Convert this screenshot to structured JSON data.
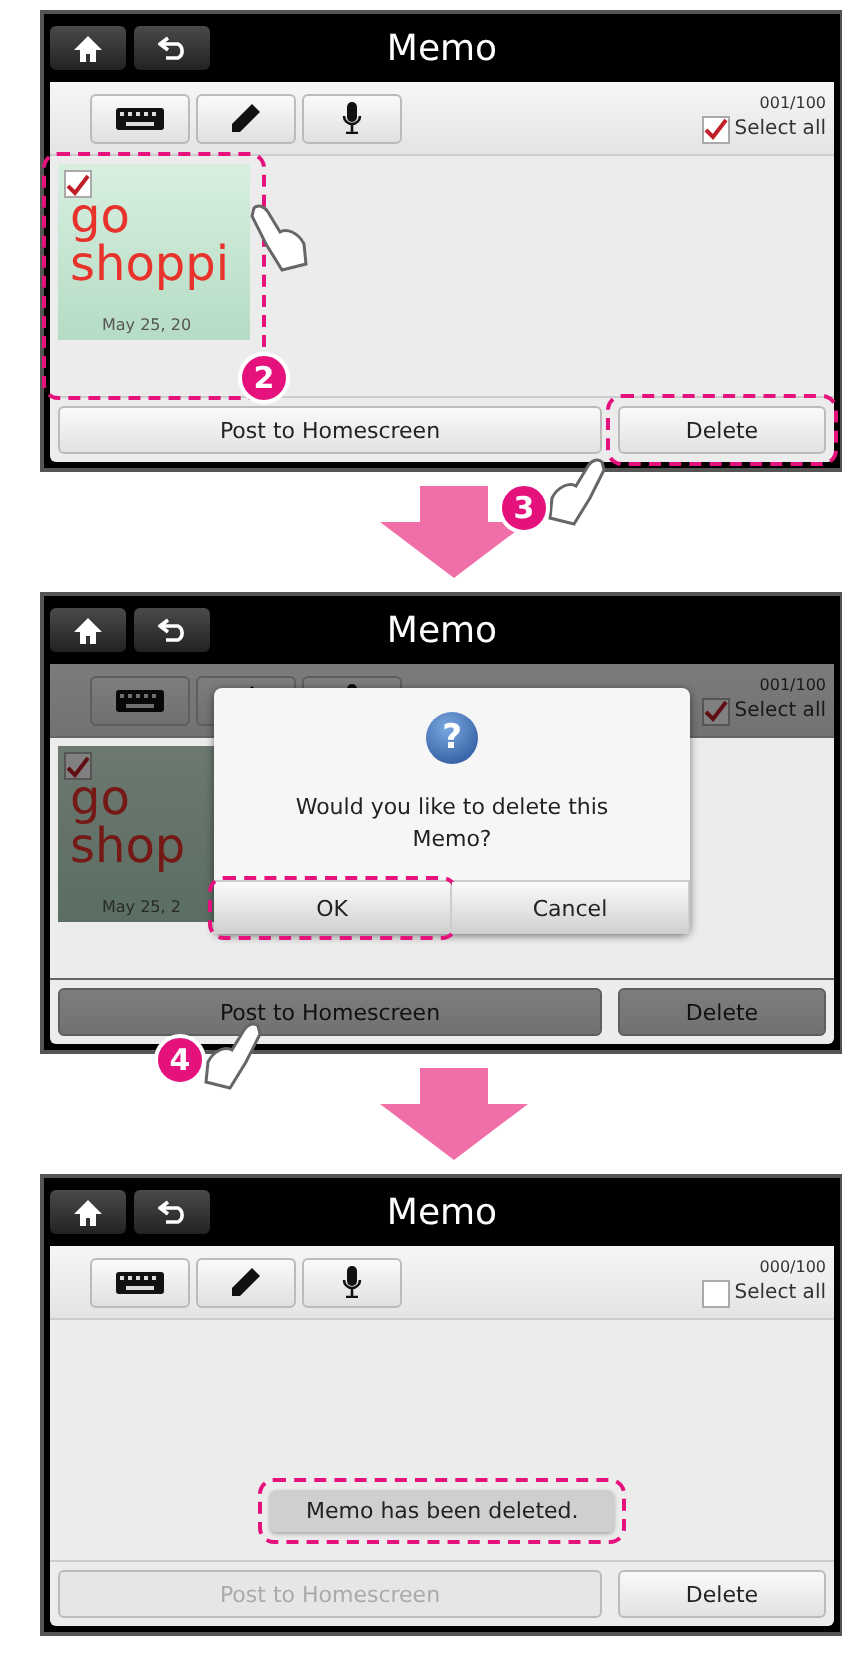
{
  "screens": [
    {
      "title": "Memo",
      "counter": "001/100",
      "select_all": {
        "label": "Select all",
        "checked": true
      },
      "memos": [
        {
          "lines": [
            "go",
            "shoppi"
          ],
          "date": "May 25, 20",
          "checked": true,
          "highlighted": true,
          "step": "2"
        }
      ],
      "buttons": [
        {
          "label": "Post to Homescreen",
          "disabled": false
        },
        {
          "label": "Delete",
          "disabled": false,
          "highlighted": true,
          "step": "3"
        }
      ]
    },
    {
      "title": "Memo",
      "counter": "001/100",
      "select_all": {
        "label": "Select all",
        "checked": true
      },
      "memos": [
        {
          "lines": [
            "go",
            "shop"
          ],
          "date": "May 25, 2",
          "checked": true
        }
      ],
      "buttons": [
        {
          "label": "Post to Homescreen",
          "disabled": false
        },
        {
          "label": "Delete",
          "disabled": false
        }
      ],
      "dialog": {
        "icon": "?",
        "message": "Would you like to delete this Memo?",
        "buttons": [
          {
            "label": "OK",
            "highlighted": true,
            "step": "4"
          },
          {
            "label": "Cancel"
          }
        ]
      }
    },
    {
      "title": "Memo",
      "counter": "000/100",
      "select_all": {
        "label": "Select all",
        "checked": false
      },
      "buttons": [
        {
          "label": "Post to Homescreen",
          "disabled": true
        },
        {
          "label": "Delete",
          "disabled": false
        }
      ],
      "toast": {
        "text": "Memo has been deleted.",
        "highlighted": true
      }
    }
  ]
}
